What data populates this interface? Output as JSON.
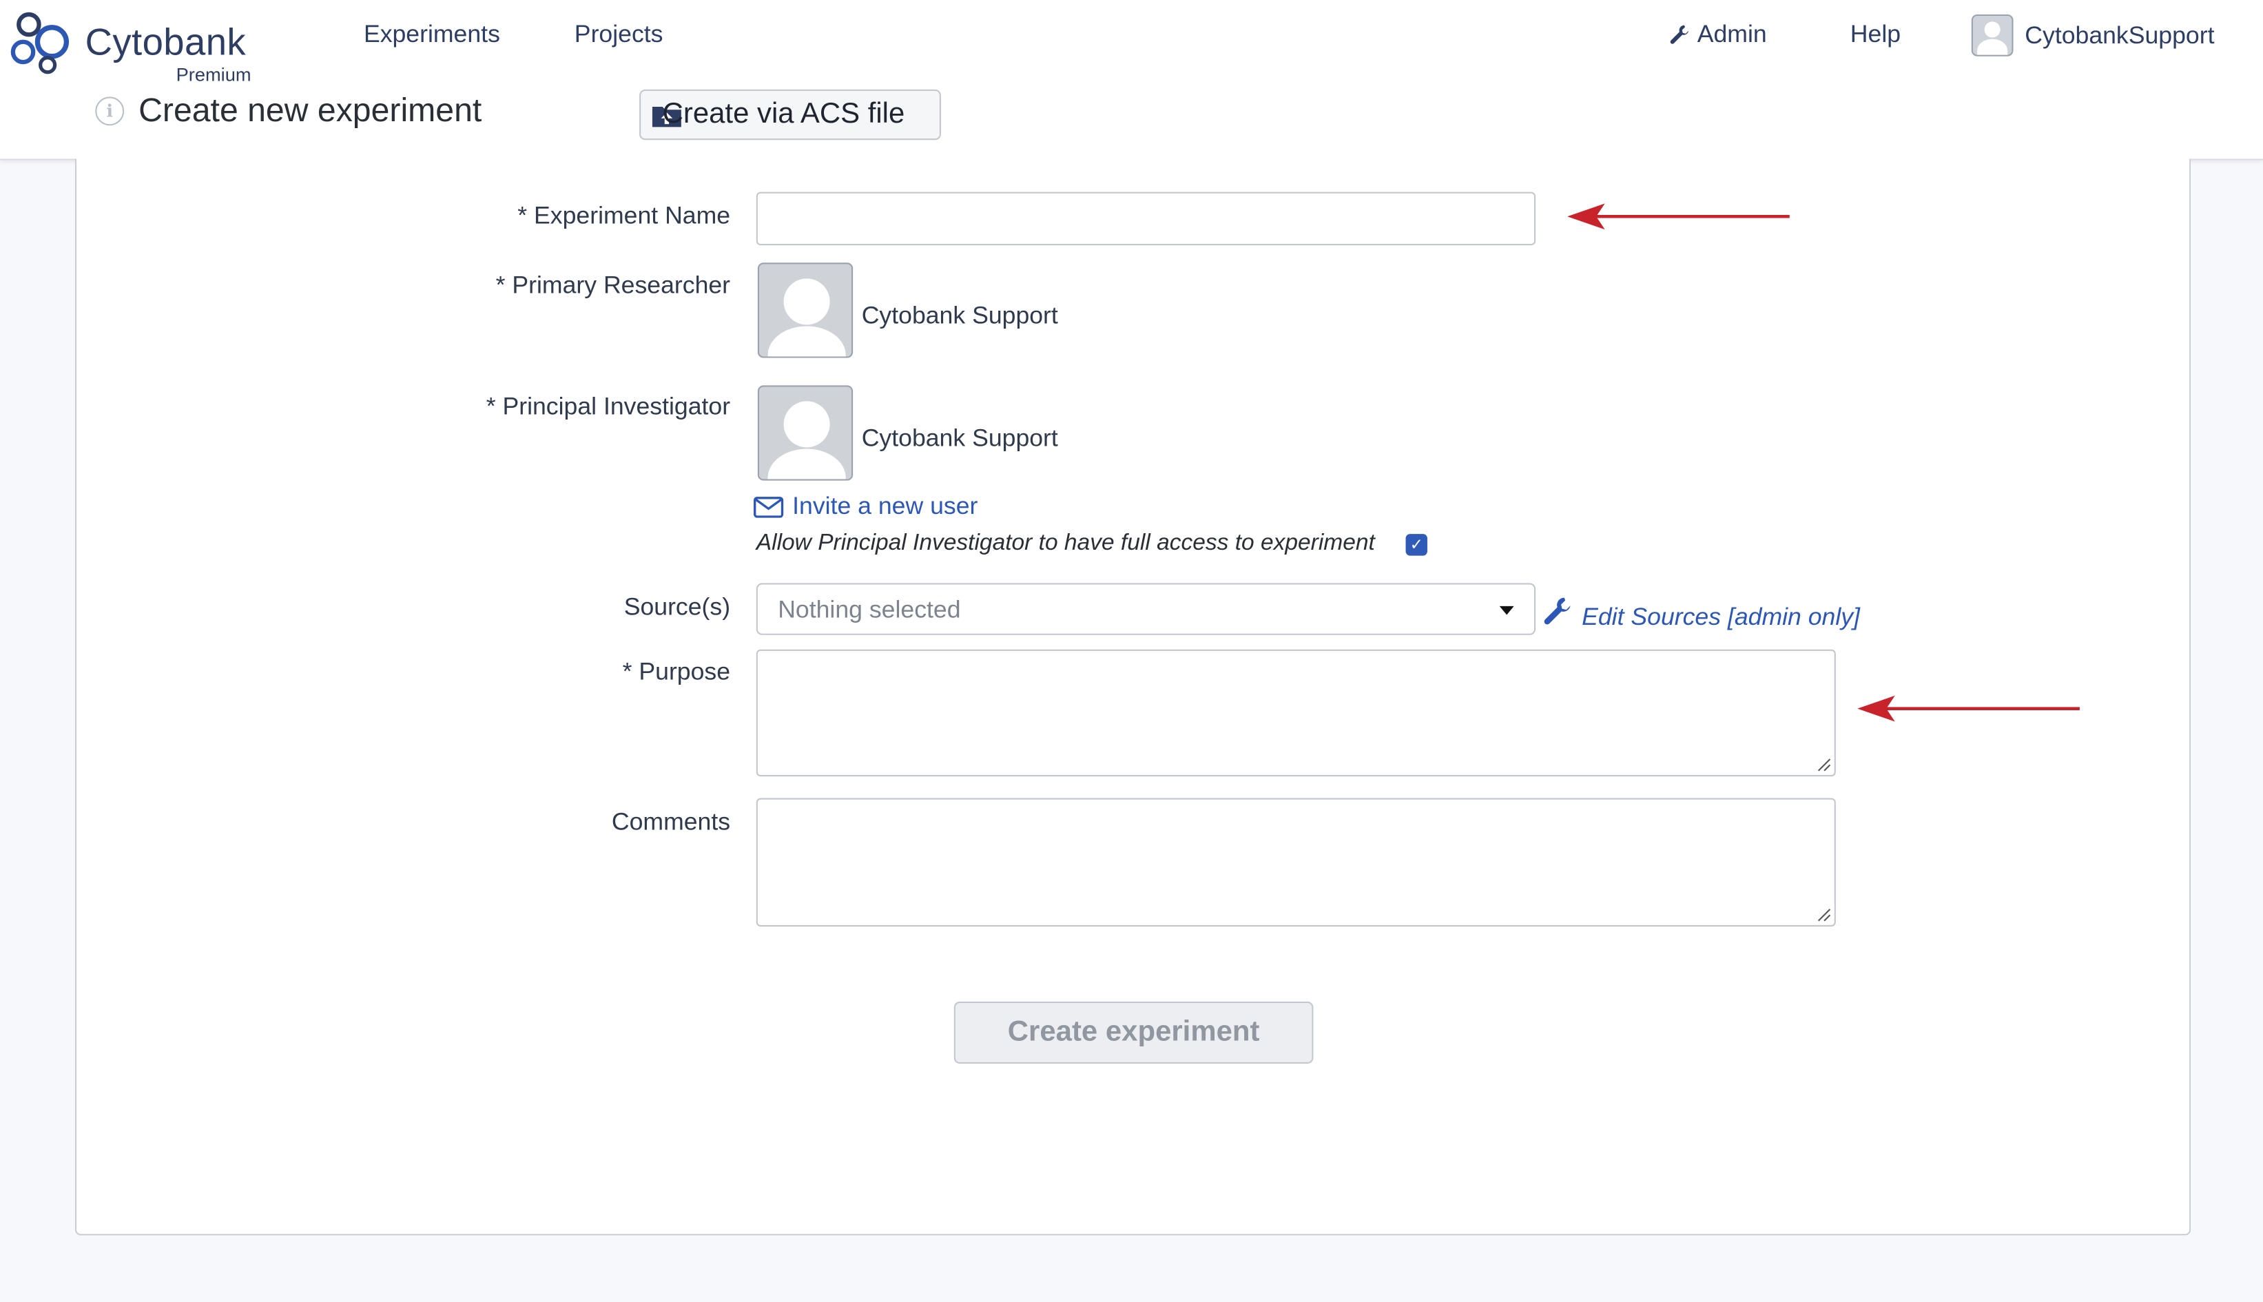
{
  "app": {
    "brand": "Cytobank",
    "tier": "Premium"
  },
  "nav": {
    "experiments": "Experiments",
    "projects": "Projects",
    "admin": "Admin",
    "help": "Help",
    "user": "CytobankSupport"
  },
  "page": {
    "title": "Create new experiment",
    "acs_button": "Create via ACS file"
  },
  "form": {
    "experiment_name_label": "* Experiment Name",
    "experiment_name_value": "",
    "primary_researcher_label": "* Primary Researcher",
    "primary_researcher_name": "Cytobank Support",
    "principal_investigator_label": "* Principal Investigator",
    "principal_investigator_name": "Cytobank Support",
    "invite_link": "Invite a new user",
    "allow_full_access_text": "Allow Principal Investigator to have full access to experiment",
    "allow_full_access_checked": true,
    "sources_label": "Source(s)",
    "sources_placeholder": "Nothing selected",
    "edit_sources_link": "Edit Sources [admin only]",
    "purpose_label": "* Purpose",
    "purpose_value": "",
    "comments_label": "Comments",
    "comments_value": "",
    "submit_label": "Create experiment"
  },
  "colors": {
    "annotation_arrow": "#c8232b",
    "link": "#2d57b5",
    "brand": "#2d3d63"
  }
}
